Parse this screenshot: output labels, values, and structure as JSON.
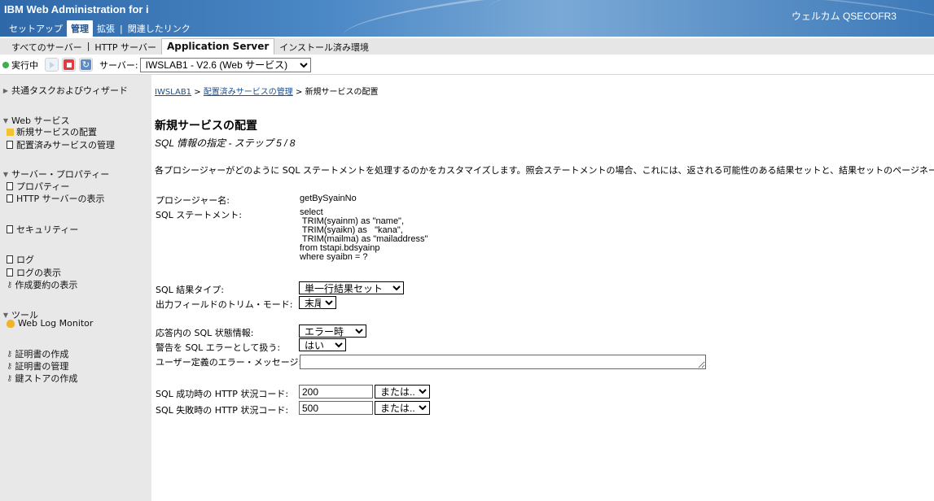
{
  "header": {
    "app_title": "IBM Web Administration for i",
    "welcome": "ウェルカム QSECOFR3",
    "nav": [
      {
        "label": "セットアップ",
        "active": false
      },
      {
        "label": "管理",
        "active": true
      },
      {
        "label": "拡張",
        "active": false
      },
      {
        "label": "関連したリンク",
        "active": false
      }
    ]
  },
  "subnav": {
    "items": [
      {
        "label": "すべてのサーバー",
        "active": false
      },
      {
        "label": "HTTP サーバー",
        "active": false
      },
      {
        "label": "Application Server",
        "active": true
      },
      {
        "label": "インストール済み環境",
        "active": false
      }
    ]
  },
  "toolbar": {
    "status": "実行中",
    "status_color": "#3cb04a",
    "server_label": "サーバー:",
    "server_value": "IWSLAB1 - V2.6 (Web サービス)"
  },
  "sidebar": {
    "common_tasks": "共通タスクおよびウィザード",
    "web_services": "Web サービス",
    "deploy_new": "新規サービスの配置",
    "manage_deployed": "配置済みサービスの管理",
    "server_props": "サーバー・プロパティー",
    "properties": "プロパティー",
    "show_http": "HTTP サーバーの表示",
    "security": "セキュリティー",
    "logs": "ログ",
    "show_logs": "ログの表示",
    "show_summary": "作成要約の表示",
    "tools": "ツール",
    "web_log_monitor": "Web Log Monitor",
    "create_cert": "証明書の作成",
    "manage_cert": "証明書の管理",
    "create_keystore": "鍵ストアの作成"
  },
  "main": {
    "breadcrumb": {
      "link1": "IWSLAB1",
      "sep1": " > ",
      "link2": "配置済みサービスの管理",
      "sep2": " > ",
      "current": "新規サービスの配置"
    },
    "title": "新規サービスの配置",
    "step": "SQL 情報の指定 - ステップ 5 / 8",
    "description": "各プロシージャーがどのように SQL ステートメントを処理するのかをカスタマイズします。照会ステートメントの場合、これには、返される可能性のある結果セットと、結果セットのページネーション",
    "procedure_label": "プロシージャー名:",
    "procedure_value": "getBySyainNo",
    "sql_label": "SQL ステートメント:",
    "sql_value": "select\n TRIM(syainm) as \"name\",\n TRIM(syaikn) as   \"kana\",\n TRIM(mailma) as \"mailaddress\"\nfrom tstapi.bdsyainp\nwhere syaibn = ?",
    "result_type_label": "SQL 結果タイプ:",
    "result_type_value": "単一行結果セット",
    "trim_mode_label": "出力フィールドのトリム・モード:",
    "trim_mode_value": "末尾",
    "sql_status_label": "応答内の SQL 状態情報:",
    "sql_status_value": "エラー時",
    "warn_label": "警告を SQL エラーとして扱う:",
    "warn_value": "はい",
    "user_error_label": "ユーザー定義のエラー・メッセージ:",
    "user_error_value": "",
    "success_label": "SQL 成功時の HTTP 状況コード:",
    "success_value": "200",
    "success_select": "または...",
    "fail_label": "SQL 失敗時の HTTP 状況コード:",
    "fail_value": "500",
    "fail_select": "または..."
  }
}
